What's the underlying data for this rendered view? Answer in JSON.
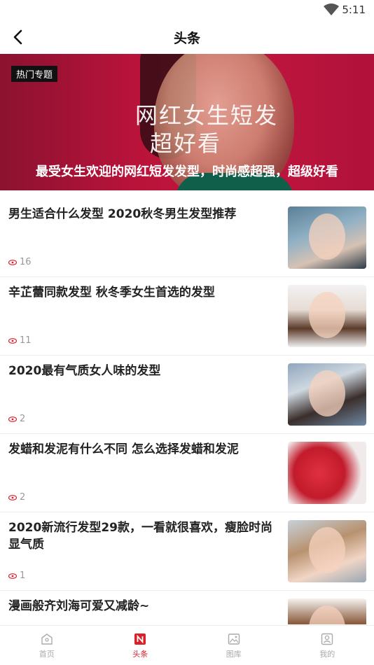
{
  "status_bar": {
    "time": "5:11",
    "wifi_icon": "wifi-icon"
  },
  "header": {
    "title": "头条",
    "back_icon": "back-arrow-icon"
  },
  "banner": {
    "badge": "热门专题",
    "headline_line1": "网红女生短发",
    "headline_line2": "超好看",
    "caption": "最受女生欢迎的网红短发发型，时尚感超强，超级好看"
  },
  "articles": [
    {
      "title": "男生适合什么发型 2020秋冬男生发型推荐",
      "views": "16"
    },
    {
      "title": "辛芷蕾同款发型 秋冬季女生首选的发型",
      "views": "11"
    },
    {
      "title": "2020最有气质女人味的发型",
      "views": "2"
    },
    {
      "title": "发蜡和发泥有什么不同 怎么选择发蜡和发泥",
      "views": "2"
    },
    {
      "title": "2020新流行发型29款，一看就很喜欢，瘦脸时尚显气质",
      "views": "1"
    },
    {
      "title": "漫画般齐刘海可爱又减龄~",
      "views": ""
    }
  ],
  "tabs": [
    {
      "label": "首页",
      "icon": "home-icon"
    },
    {
      "label": "头条",
      "icon": "news-icon",
      "active": true
    },
    {
      "label": "图库",
      "icon": "gallery-icon"
    },
    {
      "label": "我的",
      "icon": "profile-icon"
    }
  ],
  "colors": {
    "accent": "#d8222a",
    "banner": "#c3163f"
  }
}
